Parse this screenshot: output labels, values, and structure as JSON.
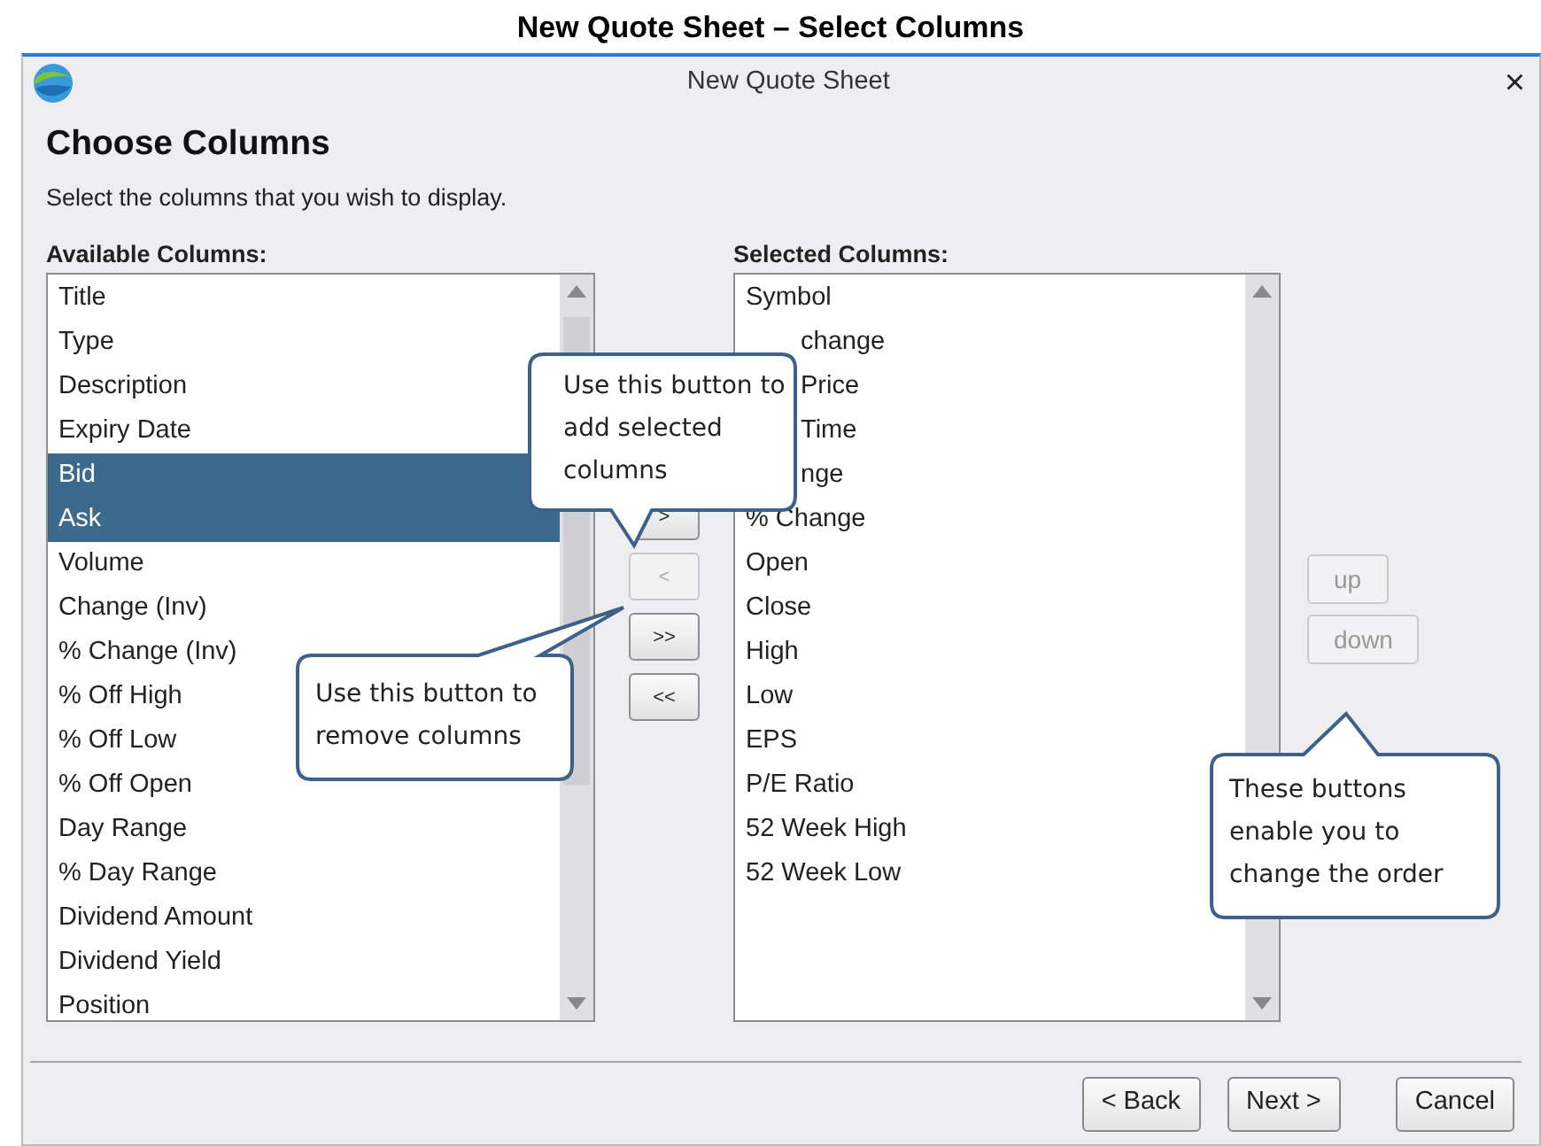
{
  "document_caption": "New Quote Sheet – Select Columns",
  "window": {
    "title": "New Quote Sheet",
    "close": "×"
  },
  "heading": "Choose Columns",
  "instructions": "Select the columns that you wish to display.",
  "available": {
    "label": "Available Columns:",
    "items": [
      {
        "text": "Title",
        "selected": false
      },
      {
        "text": "Type",
        "selected": false
      },
      {
        "text": "Description",
        "selected": false
      },
      {
        "text": "Expiry Date",
        "selected": false
      },
      {
        "text": "Bid",
        "selected": true
      },
      {
        "text": "Ask",
        "selected": true
      },
      {
        "text": "Volume",
        "selected": false
      },
      {
        "text": "Change (Inv)",
        "selected": false
      },
      {
        "text": "% Change (Inv)",
        "selected": false
      },
      {
        "text": "% Off High",
        "selected": false
      },
      {
        "text": "% Off Low",
        "selected": false
      },
      {
        "text": "% Off Open",
        "selected": false
      },
      {
        "text": "Day Range",
        "selected": false
      },
      {
        "text": "% Day Range",
        "selected": false
      },
      {
        "text": "Dividend Amount",
        "selected": false
      },
      {
        "text": "Dividend Yield",
        "selected": false
      },
      {
        "text": "Position",
        "selected": false
      }
    ]
  },
  "transfer_buttons": [
    {
      "label": ">",
      "disabled": false
    },
    {
      "label": "<",
      "disabled": true
    },
    {
      "label": ">>",
      "disabled": false
    },
    {
      "label": "<<",
      "disabled": false
    }
  ],
  "selected": {
    "label": "Selected Columns:",
    "items": [
      {
        "text": "Symbol",
        "covered": false
      },
      {
        "text": "change",
        "covered": true
      },
      {
        "text": "Price",
        "covered": true
      },
      {
        "text": "Time",
        "covered": true
      },
      {
        "text": "nge",
        "covered": true
      },
      {
        "text": "% Change",
        "covered": false
      },
      {
        "text": "Open",
        "covered": false
      },
      {
        "text": "Close",
        "covered": false
      },
      {
        "text": "High",
        "covered": false
      },
      {
        "text": "Low",
        "covered": false
      },
      {
        "text": "EPS",
        "covered": false
      },
      {
        "text": "P/E Ratio",
        "covered": false
      },
      {
        "text": "52 Week High",
        "covered": false
      },
      {
        "text": "52 Week Low",
        "covered": false
      }
    ]
  },
  "order_buttons": [
    {
      "label": "up",
      "disabled": true
    },
    {
      "label": "down",
      "disabled": true
    }
  ],
  "callouts": [
    {
      "text": "Use this button to add selected columns"
    },
    {
      "text": "Use this button to remove columns"
    },
    {
      "text": "These buttons enable you to change the order"
    }
  ],
  "footer_buttons": [
    {
      "label": "< Back"
    },
    {
      "label": "Next >"
    },
    {
      "label": "Cancel"
    }
  ]
}
